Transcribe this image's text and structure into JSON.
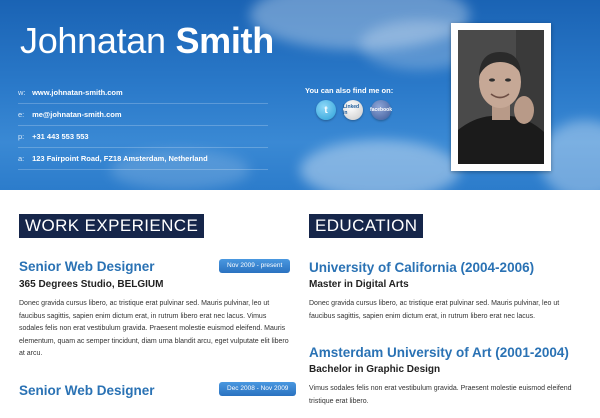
{
  "header": {
    "first_name": "Johnatan",
    "last_name": "Smith",
    "contacts": [
      {
        "label": "w:",
        "value": "www.johnatan-smith.com"
      },
      {
        "label": "e:",
        "value": "me@johnatan-smith.com"
      },
      {
        "label": "p:",
        "value": "+31 443 553 553"
      },
      {
        "label": "a:",
        "value": "123 Fairpoint Road, FZ18 Amsterdam, Netherland"
      }
    ],
    "find_me": "You can also find me on:",
    "social": [
      {
        "name": "twitter-icon",
        "text": "t"
      },
      {
        "name": "linkedin-icon",
        "text": "Linked in"
      },
      {
        "name": "facebook-icon",
        "text": "facebook"
      }
    ]
  },
  "work": {
    "heading": "WORK EXPERIENCE",
    "jobs": [
      {
        "title": "Senior Web Designer",
        "company": "365 Degrees Studio, BELGIUM",
        "dates": "Nov 2009 - present",
        "desc": "Donec gravida cursus libero, ac tristique erat pulvinar sed. Mauris pulvinar, leo ut faucibus sagittis, sapien enim dictum erat, in rutrum libero erat nec lacus. Vimus sodales felis non erat vestibulum gravida. Praesent molestie euismod eleifend. Mauris elementum, quam ac semper tincidunt, diam urna blandit arcu, eget vulputate elit libero at arcu."
      },
      {
        "title": "Senior Web Designer",
        "company": "",
        "dates": "Dec 2008 - Nov 2009",
        "desc": ""
      }
    ]
  },
  "education": {
    "heading": "EDUCATION",
    "schools": [
      {
        "title": "University of California (2004-2006)",
        "degree": "Master in Digital Arts",
        "desc": "Donec gravida cursus libero, ac tristique erat pulvinar sed. Mauris pulvinar, leo ut faucibus sagittis, sapien enim dictum erat, in rutrum libero erat nec lacus."
      },
      {
        "title": "Amsterdam University of Art (2001-2004)",
        "degree": "Bachelor in Graphic Design",
        "desc": "Vimus sodales felis non erat vestibulum gravida. Praesent molestie euismod eleifend tristique erat libero."
      }
    ]
  },
  "colors": {
    "header_blue": "#2a79c9",
    "heading_navy": "#16264a",
    "title_blue": "#2a72b4",
    "badge_blue": "#3a86d0"
  }
}
